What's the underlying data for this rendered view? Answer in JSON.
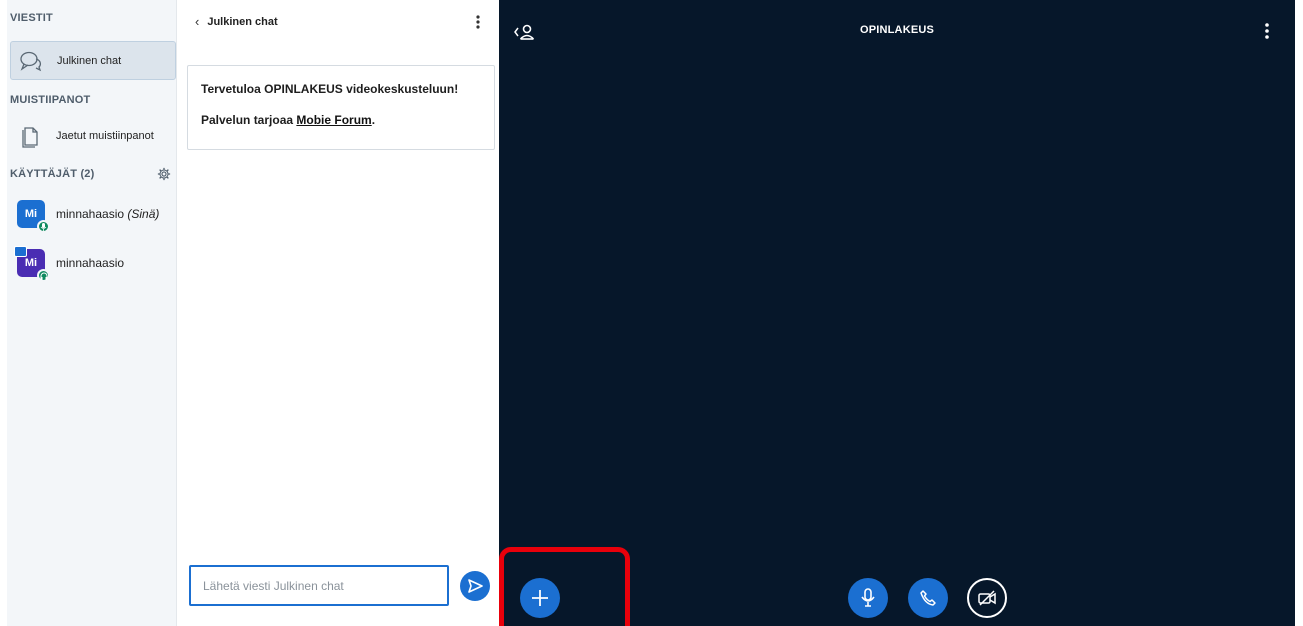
{
  "sidebar": {
    "messages_title": "VIESTIT",
    "public_chat_label": "Julkinen chat",
    "notes_title": "MUISTIIPANOT",
    "shared_notes_label": "Jaetut muistiinpanot",
    "users_title": "KÄYTTÄJÄT (2)",
    "users": [
      {
        "initials": "Mi",
        "name": "minnahaasio",
        "you_tag": "(Sinä)",
        "avatar_color": "#1b6fd1",
        "presenter": false
      },
      {
        "initials": "Mi",
        "name": "minnahaasio",
        "you_tag": "",
        "avatar_color": "#4a2db3",
        "presenter": true
      }
    ]
  },
  "chat": {
    "title": "Julkinen chat",
    "welcome_prefix": "Tervetuloa ",
    "welcome_bold": "OPINLAKEUS",
    "welcome_suffix": " videokeskusteluun!",
    "provider_prefix": "Palvelun tarjoaa ",
    "provider_link": "Mobie Forum",
    "provider_suffix": ".",
    "input_placeholder": "Lähetä viesti Julkinen chat"
  },
  "stage": {
    "meeting_title": "OPINLAKEUS"
  },
  "colors": {
    "accent": "#1b6fd1",
    "stage_bg": "#06172a",
    "highlight": "#e8000b",
    "status_green": "#0f8a5f"
  }
}
